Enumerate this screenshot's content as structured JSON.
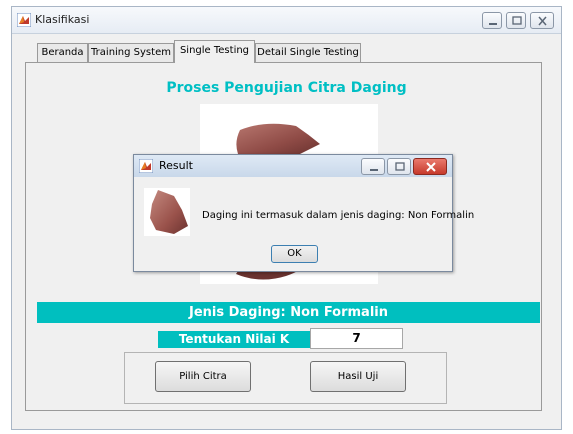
{
  "window": {
    "title": "Klasifikasi"
  },
  "tabs": [
    {
      "label": "Beranda",
      "active": false
    },
    {
      "label": "Training System",
      "active": false
    },
    {
      "label": "Single Testing",
      "active": true
    },
    {
      "label": "Detail Single Testing",
      "active": false
    }
  ],
  "main": {
    "title": "Proses Pengujian Citra Daging",
    "result_label": "Jenis Daging: Non Formalin",
    "k_label": "Tentukan Nilai K",
    "k_value": "7",
    "buttons": {
      "pilih": "Pilih Citra",
      "hasil": "Hasil Uji"
    }
  },
  "dialog": {
    "title": "Result",
    "message": "Daging ini termasuk dalam jenis daging: Non Formalin",
    "ok_label": "OK"
  },
  "colors": {
    "accent": "#00bfbf",
    "title": "#00bfc4",
    "close": "#d9453a"
  },
  "icons": {
    "app": "matlab-icon",
    "meat": "meat-image"
  }
}
